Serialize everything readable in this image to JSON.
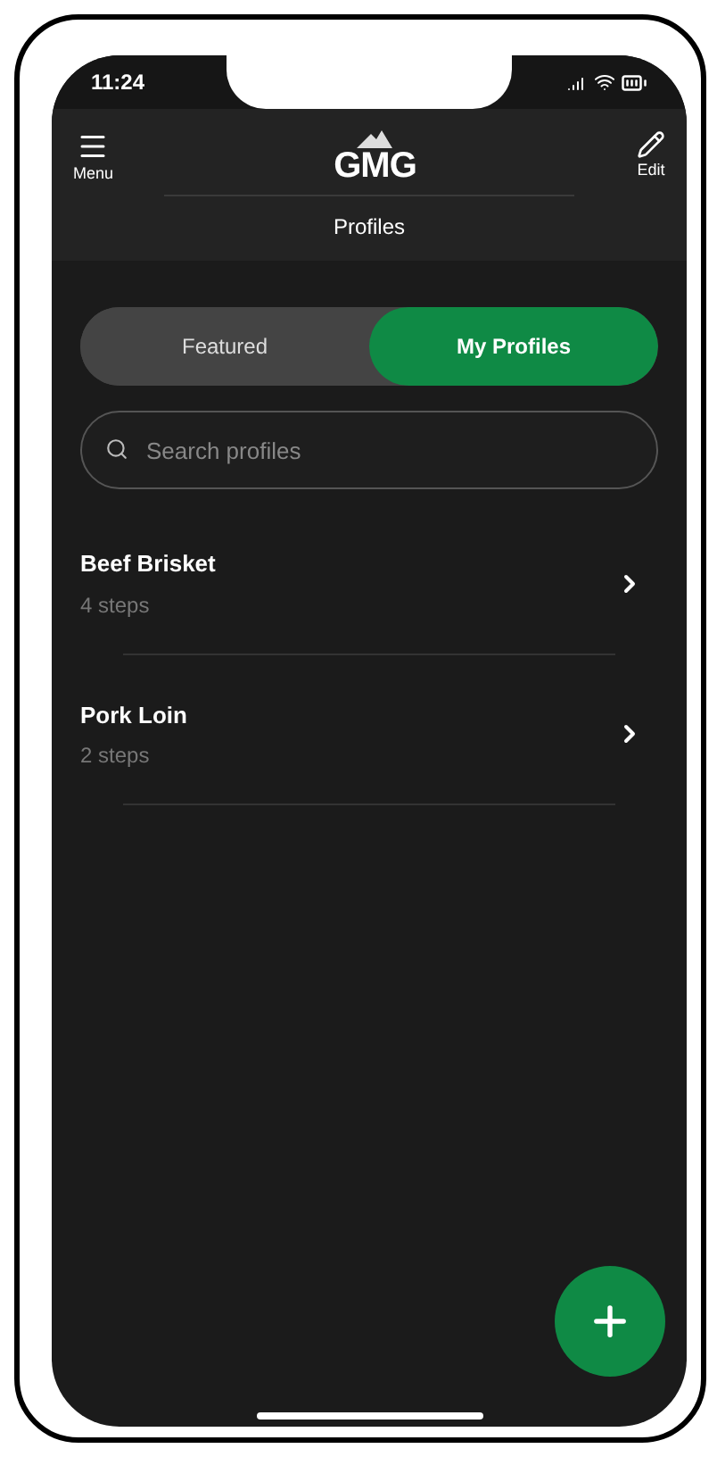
{
  "status_bar": {
    "time": "11:24"
  },
  "header": {
    "menu_label": "Menu",
    "logo": "GMG",
    "edit_label": "Edit",
    "title": "Profiles"
  },
  "tabs": [
    {
      "label": "Featured",
      "selected": false
    },
    {
      "label": "My Profiles",
      "selected": true
    }
  ],
  "search": {
    "placeholder": "Search profiles"
  },
  "profiles": [
    {
      "name": "Beef Brisket",
      "steps": "4 steps"
    },
    {
      "name": "Pork Loin",
      "steps": "2 steps"
    }
  ]
}
